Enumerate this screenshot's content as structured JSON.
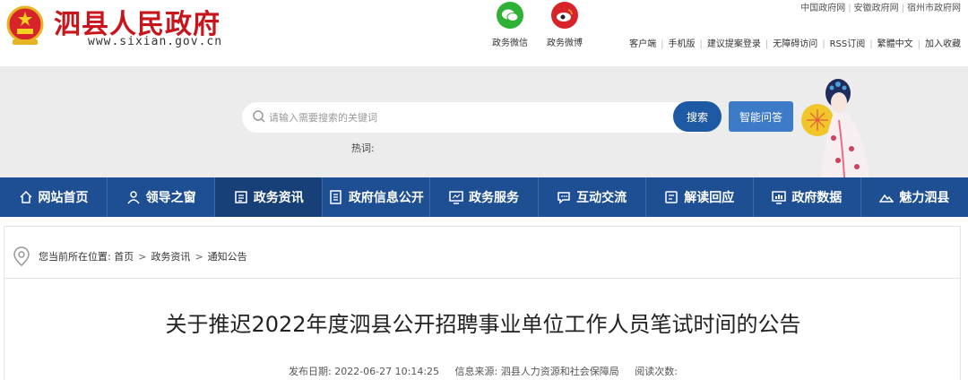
{
  "header": {
    "title": "泗县人民政府",
    "domain": "www.sixian.gov.cn",
    "social": [
      {
        "label": "政务微信",
        "icon": "wechat-icon",
        "color": "#2eb135"
      },
      {
        "label": "政务微博",
        "icon": "weibo-icon",
        "color": "#d9232b"
      }
    ],
    "top_links": [
      "中国政府网",
      "安徽政府网",
      "宿州市政府网"
    ],
    "toolbar": [
      "客户端",
      "手机版",
      "建议提案登录",
      "无障碍访问",
      "RSS订阅",
      "繁體中文",
      "加入收藏"
    ]
  },
  "search": {
    "placeholder": "请输入需要搜索的关键词",
    "button": "搜索",
    "qa_button": "智能问答",
    "hot_label": "热词:"
  },
  "nav": {
    "items": [
      {
        "label": "网站首页",
        "icon": "home-icon"
      },
      {
        "label": "领导之窗",
        "icon": "user-icon"
      },
      {
        "label": "政务资讯",
        "icon": "document-icon",
        "active": true
      },
      {
        "label": "政府信息公开",
        "icon": "list-icon"
      },
      {
        "label": "政务服务",
        "icon": "monitor-icon"
      },
      {
        "label": "互动交流",
        "icon": "chat-icon"
      },
      {
        "label": "解读回应",
        "icon": "notes-icon"
      },
      {
        "label": "政府数据",
        "icon": "chart-icon"
      },
      {
        "label": "魅力泗县",
        "icon": "mountain-icon"
      }
    ]
  },
  "breadcrumb": {
    "prefix": "您当前所在位置:",
    "items": [
      "首页",
      "政务资讯",
      "通知公告"
    ]
  },
  "article": {
    "title": "关于推迟2022年度泗县公开招聘事业单位工作人员笔试时间的公告",
    "date_label": "发布日期:",
    "date": "2022-06-27 10:14:25",
    "source_label": "信息来源:",
    "source": "泗县人力资源和社会保障局",
    "views_label": "阅读次数:"
  },
  "colors": {
    "brand_red": "#c8141b",
    "nav_blue": "#1d4f92",
    "search_blue": "#1d5aa3"
  }
}
